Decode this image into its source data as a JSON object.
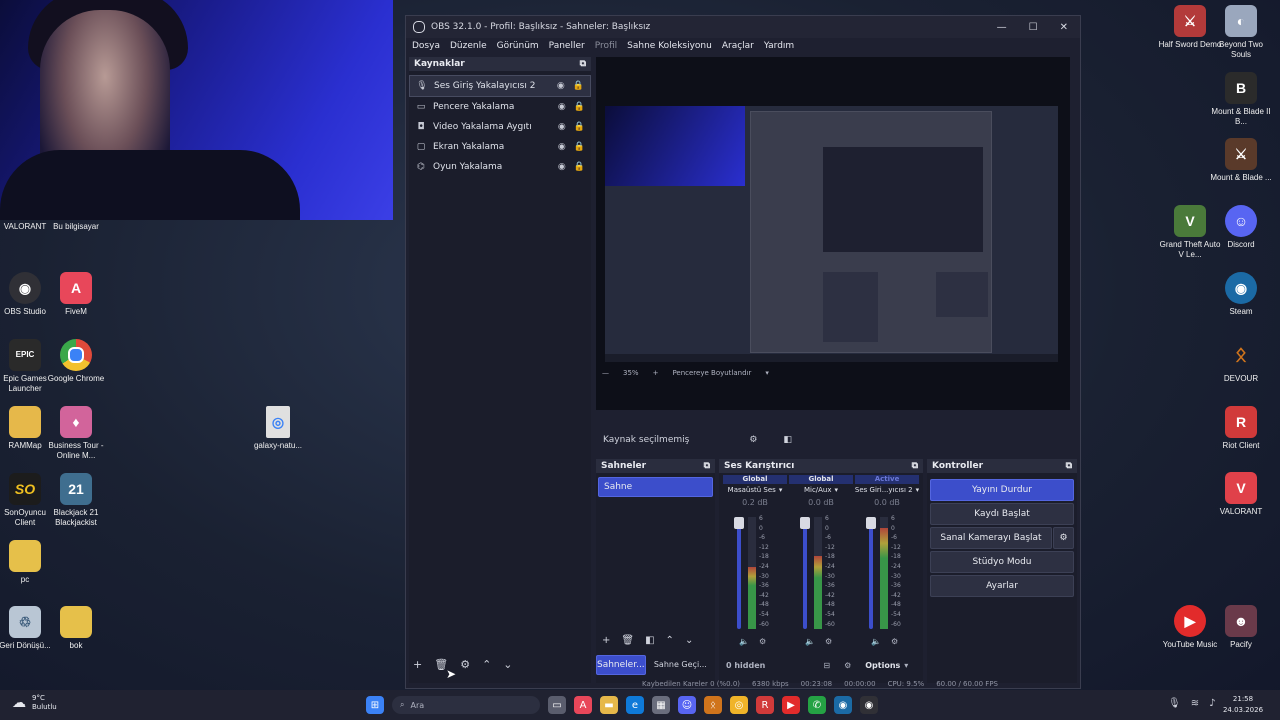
{
  "window": {
    "title": "OBS 32.1.0 - Profil: Başlıksız - Sahneler: Başlıksız",
    "menu": [
      "Dosya",
      "Düzenle",
      "Görünüm",
      "Paneller",
      "Profil",
      "Sahne Koleksiyonu",
      "Araçlar",
      "Yardım"
    ]
  },
  "sources": {
    "header": "Kaynaklar",
    "items": [
      {
        "label": "Ses Giriş Yakalayıcısı 2",
        "icon": "microphone-icon",
        "selected": true
      },
      {
        "label": "Pencere Yakalama",
        "icon": "window-icon"
      },
      {
        "label": "Video Yakalama Aygıtı",
        "icon": "camera-icon"
      },
      {
        "label": "Ekran Yakalama",
        "icon": "monitor-icon"
      },
      {
        "label": "Oyun Yakalama",
        "icon": "gamepad-icon"
      }
    ]
  },
  "preview": {
    "zoom": "35%",
    "fit_label": "Pencereye Boyutlandır",
    "no_source": "Kaynak seçilmemiş"
  },
  "scenes": {
    "header": "Sahneler",
    "items": [
      "Sahne"
    ],
    "tabs": [
      "Sahneler...",
      "Sahne Geçi..."
    ]
  },
  "mixer": {
    "header": "Ses Karıştırıcı",
    "channels": [
      {
        "badge": "Global",
        "name": "Masaüstü Ses",
        "db": "0.2 dB",
        "level": 0.55
      },
      {
        "badge": "Global",
        "name": "Mic/Aux",
        "db": "0.0 dB",
        "level": 0.65
      },
      {
        "badge": "Active",
        "name": "Ses Giri...yıcısı 2",
        "db": "0.0 dB",
        "level": 0.9
      }
    ],
    "scale": [
      "6",
      "0",
      "-6",
      "-12",
      "-18",
      "-24",
      "-30",
      "-36",
      "-42",
      "-48",
      "-54",
      "-60"
    ],
    "hidden": "0 hidden",
    "options": "Options"
  },
  "controls": {
    "header": "Kontroller",
    "buttons": [
      "Yayını Durdur",
      "Kaydı Başlat",
      "Sanal Kamerayı Başlat",
      "Stüdyo Modu",
      "Ayarlar"
    ]
  },
  "statusbar": {
    "dropped": "Kaybedilen Kareler 0 (%0.0)",
    "bitrate": "6380 kbps",
    "stream_time": "00:23:08",
    "rec_time": "00:00:00",
    "cpu": "CPU: 9.5%",
    "fps": "60.00 / 60.00 FPS"
  },
  "desktop": {
    "left": [
      {
        "label": "VALORANT",
        "color": "#e0414a",
        "glyph": "V"
      },
      {
        "label": "Bu bilgisayar",
        "color": "#3d8fd6",
        "glyph": "▭"
      },
      {
        "label": "OBS Studio",
        "color": "#303036",
        "glyph": "◉"
      },
      {
        "label": "FiveM",
        "color": "#e8475a",
        "glyph": "A"
      },
      {
        "label": "Epic Games Launcher",
        "color": "#2a2a2a",
        "glyph": "EPIC"
      },
      {
        "label": "Google Chrome",
        "color": "#f0b429",
        "glyph": "◎"
      },
      {
        "label": "RAMMap",
        "color": "#e6b84a",
        "glyph": "▬"
      },
      {
        "label": "Business Tour - Online M...",
        "color": "#d2649b",
        "glyph": "♦"
      },
      {
        "label": "SonOyuncu Client",
        "color": "#1c1c1c",
        "glyph": "SO"
      },
      {
        "label": "Blackjack 21 Blackjackist",
        "color": "#3f6e8f",
        "glyph": "21"
      },
      {
        "label": "pc",
        "color": "#e6c04a",
        "glyph": "▬"
      },
      {
        "label": "Geri Dönüşü...",
        "color": "#b9c6d4",
        "glyph": "♲"
      },
      {
        "label": "bok",
        "color": "#e6c04a",
        "glyph": "▬"
      },
      {
        "label": "galaxy-natu...",
        "color": "#e0e0e0",
        "glyph": "◎"
      }
    ],
    "right": [
      {
        "label": "Half Sword Demo",
        "color": "#b33a3a",
        "glyph": "⚔"
      },
      {
        "label": "Beyond Two Souls",
        "color": "#9aa7bd",
        "glyph": "◐"
      },
      {
        "label": "Mount & Blade II B...",
        "color": "#2b2b2b",
        "glyph": "B"
      },
      {
        "label": "Mount & Blade ...",
        "color": "#5a3a2a",
        "glyph": "⚔"
      },
      {
        "label": "Grand Theft Auto V Le...",
        "color": "#4a7a3a",
        "glyph": "V"
      },
      {
        "label": "Discord",
        "color": "#5865f2",
        "glyph": "☺"
      },
      {
        "label": "Steam",
        "color": "#1b6aa5",
        "glyph": "◉"
      },
      {
        "label": "DEVOUR",
        "color": "#d0741c",
        "glyph": "ᛟ"
      },
      {
        "label": "Riot Client",
        "color": "#d13a3a",
        "glyph": "R"
      },
      {
        "label": "VALORANT",
        "color": "#e0414a",
        "glyph": "V"
      },
      {
        "label": "YouTube Music",
        "color": "#e22b2b",
        "glyph": "▶"
      },
      {
        "label": "Pacify",
        "color": "#6a3a4a",
        "glyph": "☻"
      }
    ]
  },
  "taskbar": {
    "weather_temp": "9°C",
    "weather_desc": "Bulutlu",
    "search_placeholder": "Ara",
    "time": "21:58",
    "date": "24.03.2026"
  },
  "colors": {
    "accent": "#3c4ecb",
    "obs_bg": "#1e2030",
    "meter_green": "#3aa84a"
  }
}
